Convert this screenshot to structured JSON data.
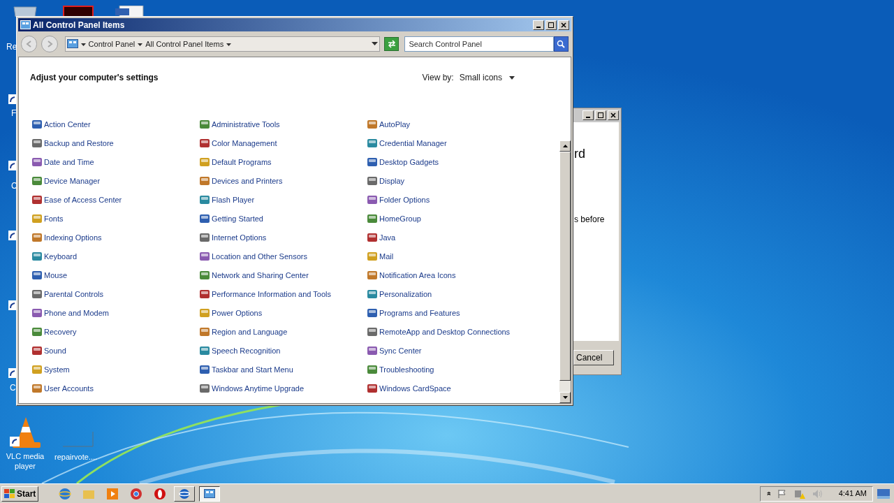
{
  "desktop": {
    "icons": [
      {
        "label": "Re"
      },
      {
        "label": "F"
      },
      {
        "label": "C"
      },
      {
        "label": "C"
      },
      {
        "label": "VLC media player"
      },
      {
        "label": "repairvote...."
      }
    ]
  },
  "window": {
    "title": "All Control Panel Items"
  },
  "address": {
    "crumbs": [
      "Control Panel",
      "All Control Panel Items"
    ]
  },
  "search": {
    "placeholder": "Search Control Panel"
  },
  "heading": "Adjust your computer's settings",
  "view_by": {
    "label": "View by:",
    "value": "Small icons"
  },
  "items": [
    "Action Center",
    "Administrative Tools",
    "AutoPlay",
    "Backup and Restore",
    "Color Management",
    "Credential Manager",
    "Date and Time",
    "Default Programs",
    "Desktop Gadgets",
    "Device Manager",
    "Devices and Printers",
    "Display",
    "Ease of Access Center",
    "Flash Player",
    "Folder Options",
    "Fonts",
    "Getting Started",
    "HomeGroup",
    "Indexing Options",
    "Internet Options",
    "Java",
    "Keyboard",
    "Location and Other Sensors",
    "Mail",
    "Mouse",
    "Network and Sharing Center",
    "Notification Area Icons",
    "Parental Controls",
    "Performance Information and Tools",
    "Personalization",
    "Phone and Modem",
    "Power Options",
    "Programs and Features",
    "Recovery",
    "Region and Language",
    "RemoteApp and Desktop Connections",
    "Sound",
    "Speech Recognition",
    "Sync Center",
    "System",
    "Taskbar and Start Menu",
    "Troubleshooting",
    "User Accounts",
    "Windows Anytime Upgrade",
    "Windows CardSpace"
  ],
  "back_window": {
    "heading": "rd",
    "text": "s before",
    "button": "Cancel"
  },
  "taskbar": {
    "start": "Start",
    "clock": "4:41 AM",
    "tray_expand": "»"
  }
}
